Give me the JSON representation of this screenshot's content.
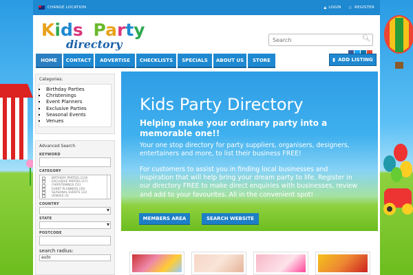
{
  "topbar": {
    "change_location": "CHANGE LOCATION",
    "login": "LOGIN",
    "register": "REGISTER"
  },
  "logo": {
    "line1": "Kids Party",
    "line2": "directory"
  },
  "search": {
    "placeholder": "Search"
  },
  "nav": {
    "tabs": [
      "HOME",
      "CONTACT",
      "ADVERTISE",
      "CHECKLISTS",
      "SPECIALS",
      "ABOUT US",
      "STORE"
    ],
    "add_listing": "ADD LISTING"
  },
  "sidebar": {
    "categories_title": "Categories:",
    "categories": [
      "Birthday Parties",
      "Christenings",
      "Event Planners",
      "Exclusive Parties",
      "Seasonal Events",
      "Venues"
    ],
    "advanced_title": "Advanced Search",
    "keyword_label": "KEYWORD",
    "category_label": "CATEGORY",
    "category_options": [
      "BIRTHDAY PARTIES (219)",
      "EXCLUSIVE PARTIES (57)",
      "CHRISTENINGS (51)",
      "EVENT PLANNERS (26)",
      "SEASONAL EVENTS (22)",
      "VENUES (4)"
    ],
    "country_label": "COUNTRY",
    "state_label": "STATE",
    "postcode_label": "POSTCODE",
    "radius_label": "search radius:",
    "radius_value": "auto"
  },
  "hero": {
    "title": "Kids Party Directory",
    "subtitle": "Helping make your ordinary party into a memorable one!!",
    "p1": "Your one stop directory for party suppliers, organisers, designers, entertainers and more, to list their business FREE!",
    "p2": "For customers to assist you in finding local businesses and inspiration that will help bring your dream party to life. Register in our directory FREE to make direct enquiries with businesses, review and add to your favourites. All in the convenient spot!",
    "members_btn": "MEMBERS AREA",
    "search_btn": "SEARCH WEBSITE"
  },
  "colors": {
    "primary": "#1e88d0",
    "sky": "#3fb0ee",
    "grass": "#6cbd1f"
  }
}
